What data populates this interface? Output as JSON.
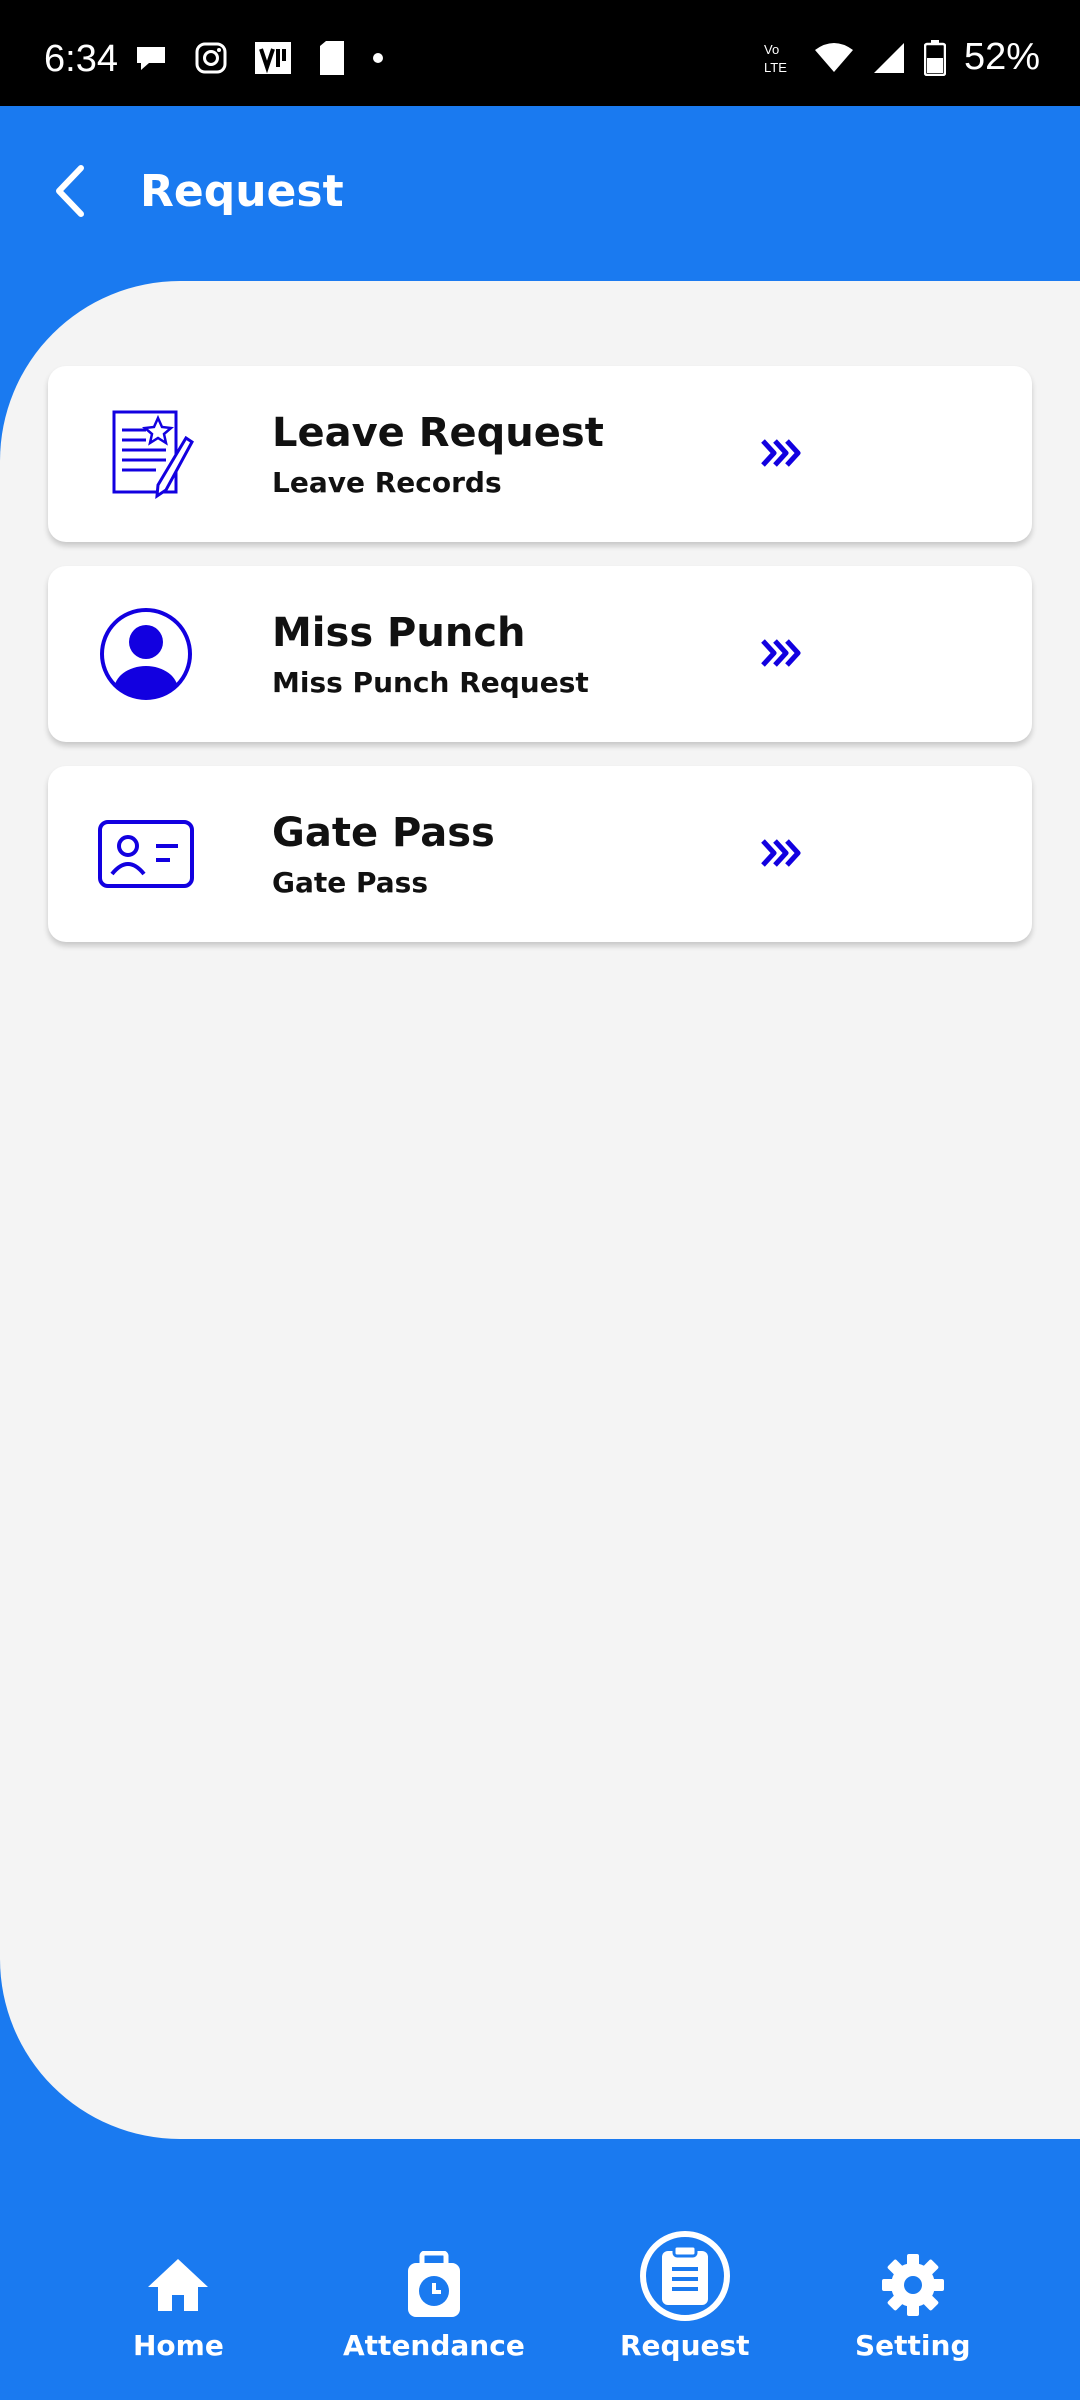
{
  "status_bar": {
    "time": "6:34",
    "battery": "52%"
  },
  "header": {
    "title": "Request"
  },
  "cards": [
    {
      "title": "Leave Request",
      "subtitle": "Leave Records",
      "icon": "document-pen-icon"
    },
    {
      "title": "Miss Punch",
      "subtitle": "Miss Punch Request",
      "icon": "user-circle-icon"
    },
    {
      "title": "Gate Pass",
      "subtitle": "Gate Pass",
      "icon": "id-card-icon"
    }
  ],
  "bottom_nav": {
    "items": [
      {
        "label": "Home",
        "icon": "home-icon"
      },
      {
        "label": "Attendance",
        "icon": "clock-bag-icon"
      },
      {
        "label": "Request",
        "icon": "clipboard-icon"
      },
      {
        "label": "Setting",
        "icon": "gear-icon"
      }
    ],
    "active_index": 2
  },
  "colors": {
    "primary": "#1a7af0",
    "accent_icon": "#1200e0",
    "panel_bg": "#f4f4f4"
  }
}
